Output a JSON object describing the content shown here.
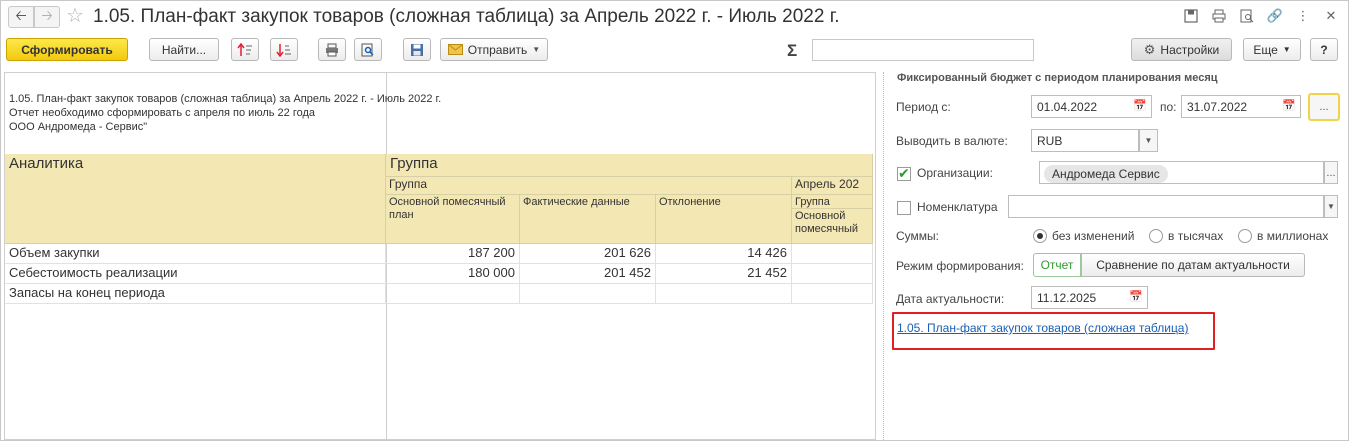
{
  "window": {
    "title": "1.05. План-факт закупок товаров (сложная таблица)  за Апрель 2022 г. - Июль 2022 г."
  },
  "toolbar": {
    "generate_label": "Сформировать",
    "find_label": "Найти...",
    "send_label": "Отправить",
    "sigma": "Σ",
    "sum_value": "",
    "settings_label": "Настройки",
    "more_label": "Еще",
    "help_label": "?"
  },
  "report": {
    "header_lines": [
      "1.05. План-факт закупок товаров (сложная таблица) за Апрель 2022 г. - Июль 2022 г.",
      "Отчет необходимо сформировать с апреля по июль 22 года",
      "ООО Андромеда - Сервис\""
    ],
    "table": {
      "col_analytics": "Аналитика",
      "col_group_top": "Группа",
      "col_group_sub": "Группа",
      "col_april": "Апрель 202",
      "col_plan": "Основной помесячный план",
      "col_fact": "Фактические данные",
      "col_dev": "Отклонение",
      "col_april_group": "Группа",
      "col_april_plan": "Основной помесячный",
      "rows": [
        {
          "name": "Объем закупки",
          "plan": "187 200",
          "fact": "201 626",
          "dev": "14 426"
        },
        {
          "name": "Себестоимость реализации",
          "plan": "180 000",
          "fact": "201 452",
          "dev": "21 452"
        },
        {
          "name": "Запасы на конец периода",
          "plan": "",
          "fact": "",
          "dev": ""
        }
      ]
    }
  },
  "settings": {
    "heading": "Фиксированный бюджет с периодом планирования месяц",
    "period_label": "Период с:",
    "period_from": "01.04.2022",
    "period_to_label": "по:",
    "period_to": "31.07.2022",
    "period_more": "...",
    "currency_label": "Выводить в валюте:",
    "currency_value": "RUB",
    "org_label": "Организации:",
    "org_checked": true,
    "org_value": "Андромеда Сервис",
    "nomenclature_label": "Номенклатура",
    "nomenclature_checked": false,
    "nomenclature_value": "",
    "sums_label": "Суммы:",
    "sums_options": [
      "без изменений",
      "в тысячах",
      "в миллионах"
    ],
    "sums_selected": "без изменений",
    "mode_label": "Режим формирования:",
    "mode_options": [
      "Отчет",
      "Сравнение по датам актуальности"
    ],
    "mode_selected": "Отчет",
    "actual_date_label": "Дата актуальности:",
    "actual_date": "11.12.2025",
    "report_link": "1.05. План-факт закупок товаров (сложная таблица)"
  },
  "colors": {
    "accent_yellow": "#f3c90e",
    "header_fill": "#f3e7b4",
    "link_blue": "#1a5fb4",
    "highlight_red": "#e02020",
    "active_green": "#2e9a2e"
  }
}
